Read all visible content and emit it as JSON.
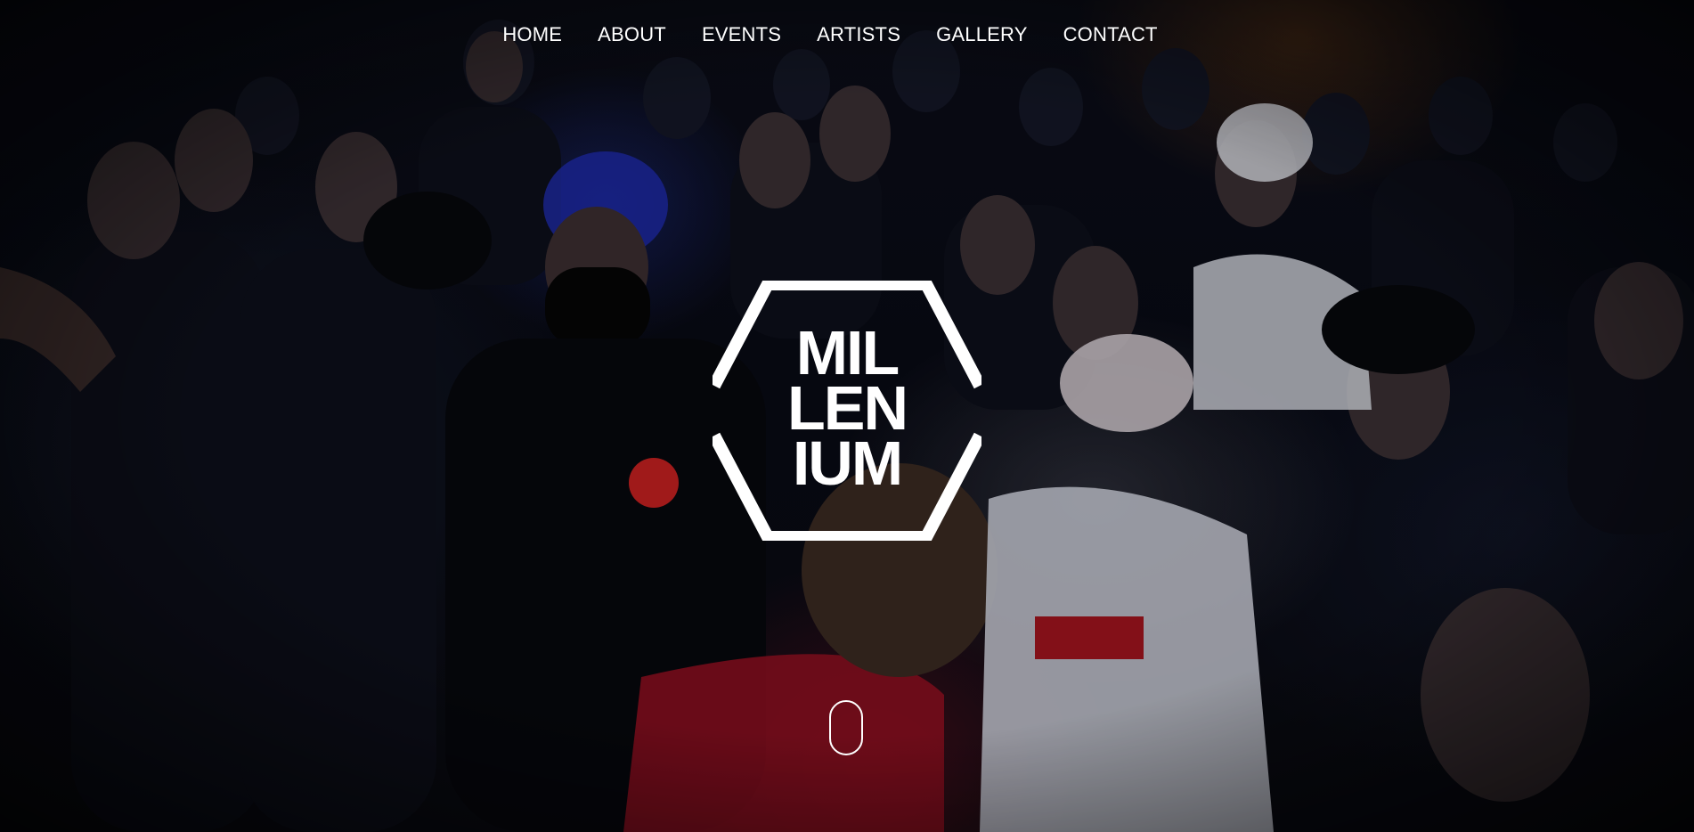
{
  "nav": {
    "items": [
      {
        "label": "HOME"
      },
      {
        "label": "ABOUT"
      },
      {
        "label": "EVENTS"
      },
      {
        "label": "ARTISTS"
      },
      {
        "label": "GALLERY"
      },
      {
        "label": "CONTACT"
      }
    ]
  },
  "logo": {
    "lines": [
      "MIL",
      "LEN",
      "IUM"
    ]
  },
  "hero": {
    "image_icon": "crowd-photo",
    "scroll_icon": "mouse-scroll-icon",
    "colors": {
      "background": "#05060c",
      "text": "#ffffff"
    }
  }
}
